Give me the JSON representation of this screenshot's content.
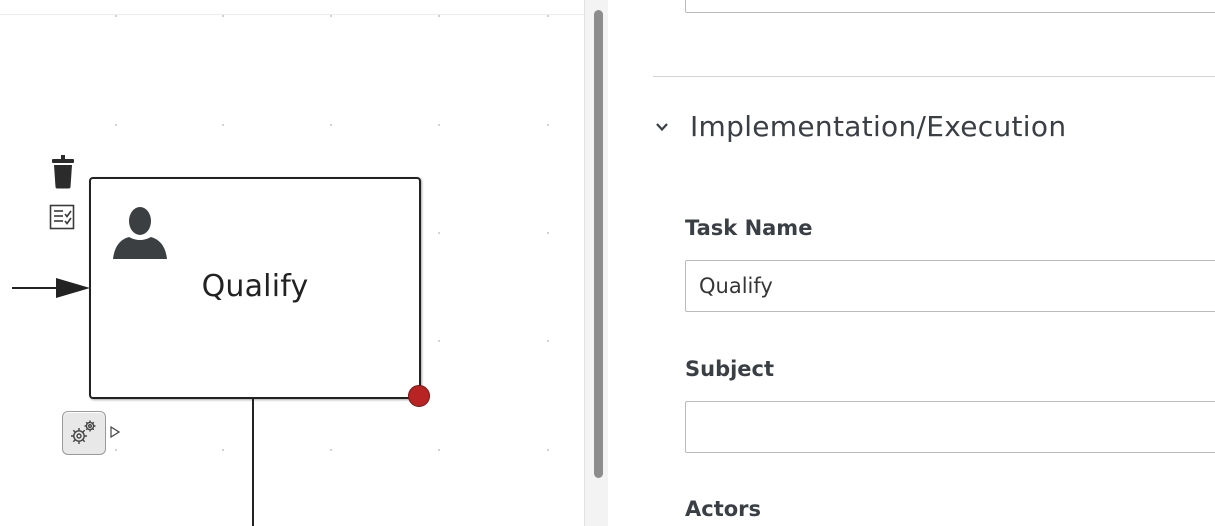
{
  "canvas": {
    "task": {
      "name": "Qualify",
      "type": "user-task",
      "icon": "user-icon"
    },
    "toolbox": {
      "delete_icon": "trash-icon",
      "documentation_icon": "document-checklist-icon",
      "morph_icon": "gears-icon"
    },
    "colors": {
      "node_border": "#222222",
      "resize_handle": "#b82323",
      "grid_dot": "#c4c4c4"
    }
  },
  "properties_panel": {
    "section": {
      "title": "Implementation/Execution",
      "expanded": true,
      "icon": "chevron-down-icon"
    },
    "fields": {
      "task_name": {
        "label": "Task Name",
        "value": "Qualify"
      },
      "subject": {
        "label": "Subject",
        "value": ""
      },
      "actors": {
        "label": "Actors"
      }
    }
  }
}
